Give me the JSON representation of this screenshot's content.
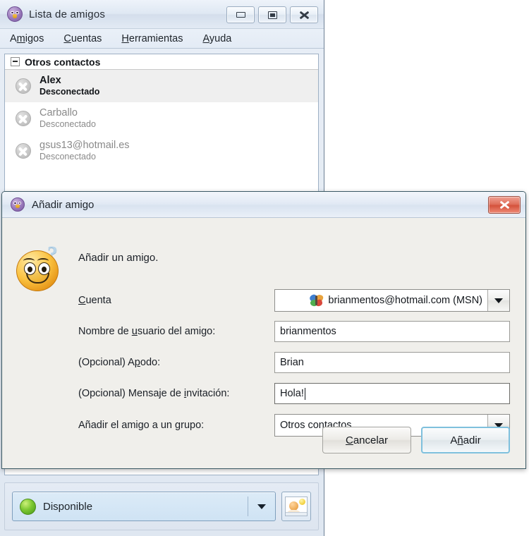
{
  "main_window": {
    "title": "Lista de amigos",
    "icon": "pidgin-bird-icon",
    "window_buttons": [
      {
        "name": "minimize-button",
        "glyph": "minimize"
      },
      {
        "name": "maximize-button",
        "glyph": "maximize"
      },
      {
        "name": "close-button",
        "glyph": "close"
      }
    ],
    "menu": [
      {
        "label_pre": "A",
        "label_mnemonic": "m",
        "label_post": "igos"
      },
      {
        "label_pre": "",
        "label_mnemonic": "C",
        "label_post": "uentas"
      },
      {
        "label_pre": "",
        "label_mnemonic": "H",
        "label_post": "erramientas"
      },
      {
        "label_pre": "",
        "label_mnemonic": "A",
        "label_post": "yuda"
      }
    ],
    "group": {
      "label": "Otros contactos",
      "expanded": true
    },
    "contacts": [
      {
        "name": "Alex",
        "status": "Desconectado",
        "state": "offline",
        "selected": true
      },
      {
        "name": "Carballo",
        "status": "Desconectado",
        "state": "offline",
        "selected": false
      },
      {
        "name": "gsus13@hotmail.es",
        "status": "Desconectado",
        "state": "offline",
        "selected": false
      }
    ],
    "status_bar": {
      "status_label": "Disponible",
      "status_color": "#7dc832",
      "avatar_button_name": "buddy-icon-button"
    }
  },
  "dialog": {
    "title": "Añadir amigo",
    "icon": "pidgin-bird-icon",
    "close_label": "×",
    "heading": "Añadir un amigo.",
    "smiley_icon": "smiley-question-icon",
    "fields": [
      {
        "id": "account",
        "label_pre": "",
        "label_mnemonic": "C",
        "label_post": "uenta",
        "type": "combo",
        "value": "brianmentos@hotmail.com (MSN)",
        "icon": "msn-butterfly-icon",
        "align": "right"
      },
      {
        "id": "username",
        "label_pre": "Nombre de ",
        "label_mnemonic": "u",
        "label_post": "suario del amigo:",
        "type": "text",
        "value": "brianmentos",
        "focused": false
      },
      {
        "id": "alias",
        "label_pre": "(Opcional) A",
        "label_mnemonic": "p",
        "label_post": "odo:",
        "type": "text",
        "value": "Brian",
        "focused": false
      },
      {
        "id": "invite",
        "label_pre": "(Opcional) Mensaje de ",
        "label_mnemonic": "i",
        "label_post": "nvitación:",
        "type": "text",
        "value": "Hola!",
        "focused": true
      },
      {
        "id": "group",
        "label_pre": "Añadir el amigo a un ",
        "label_mnemonic": "g",
        "label_post": "rupo:",
        "type": "combo",
        "value": "Otros contactos",
        "align": "left"
      }
    ],
    "buttons": {
      "cancel": {
        "pre": "",
        "mnemonic": "C",
        "post": "ancelar"
      },
      "add": {
        "pre": "A",
        "mnemonic": "ñ",
        "post": "adir"
      }
    }
  },
  "colors": {
    "accent_blue": "#7fc0dd",
    "close_red": "#d4523c",
    "available_green": "#7dc832",
    "title_gradient_top": "#f3f6fb"
  }
}
